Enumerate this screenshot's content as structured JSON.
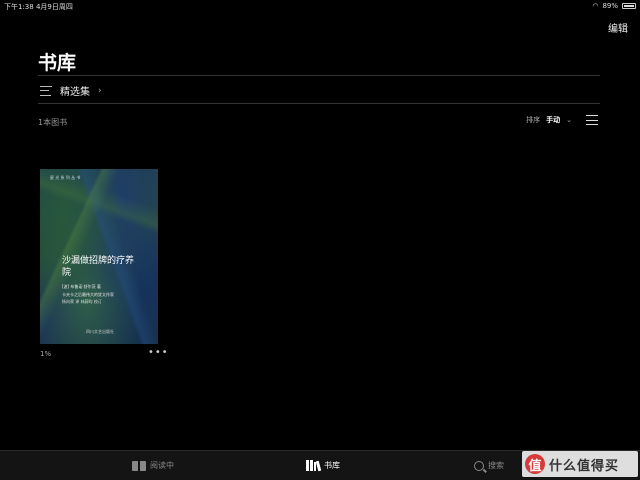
{
  "status_bar": {
    "time_date": "下午1:38  4月9日周四",
    "battery": "89%"
  },
  "header": {
    "edit_label": "编辑",
    "title": "书库"
  },
  "collections": {
    "label": "精选集",
    "chevron": "›"
  },
  "library": {
    "book_count": "1本图书",
    "sort_label": "排序",
    "sort_value": "手动",
    "sort_chevron": "⌄"
  },
  "books": [
    {
      "cover_top": "星 光 系 列 丛 书",
      "title": "沙漏做招牌的疗养院",
      "author": "[波] 布鲁诺·舒尔茨 著",
      "subtitle": "卡夫卡之后最伟大的犹太作家",
      "credits": "杨向荣 译  林蔚昀 校订",
      "publisher": "四川文艺出版社",
      "progress": "1%",
      "more": "•••"
    }
  ],
  "tab_bar": {
    "reading_now": "阅读中",
    "library": "书库",
    "search": "搜索"
  },
  "watermark": {
    "logo": "值",
    "text": "什么值得买"
  },
  "colors": {
    "background": "#000000",
    "tab_bar": "#141414",
    "active_tab": "#ffffff",
    "inactive_tab": "#888888"
  }
}
